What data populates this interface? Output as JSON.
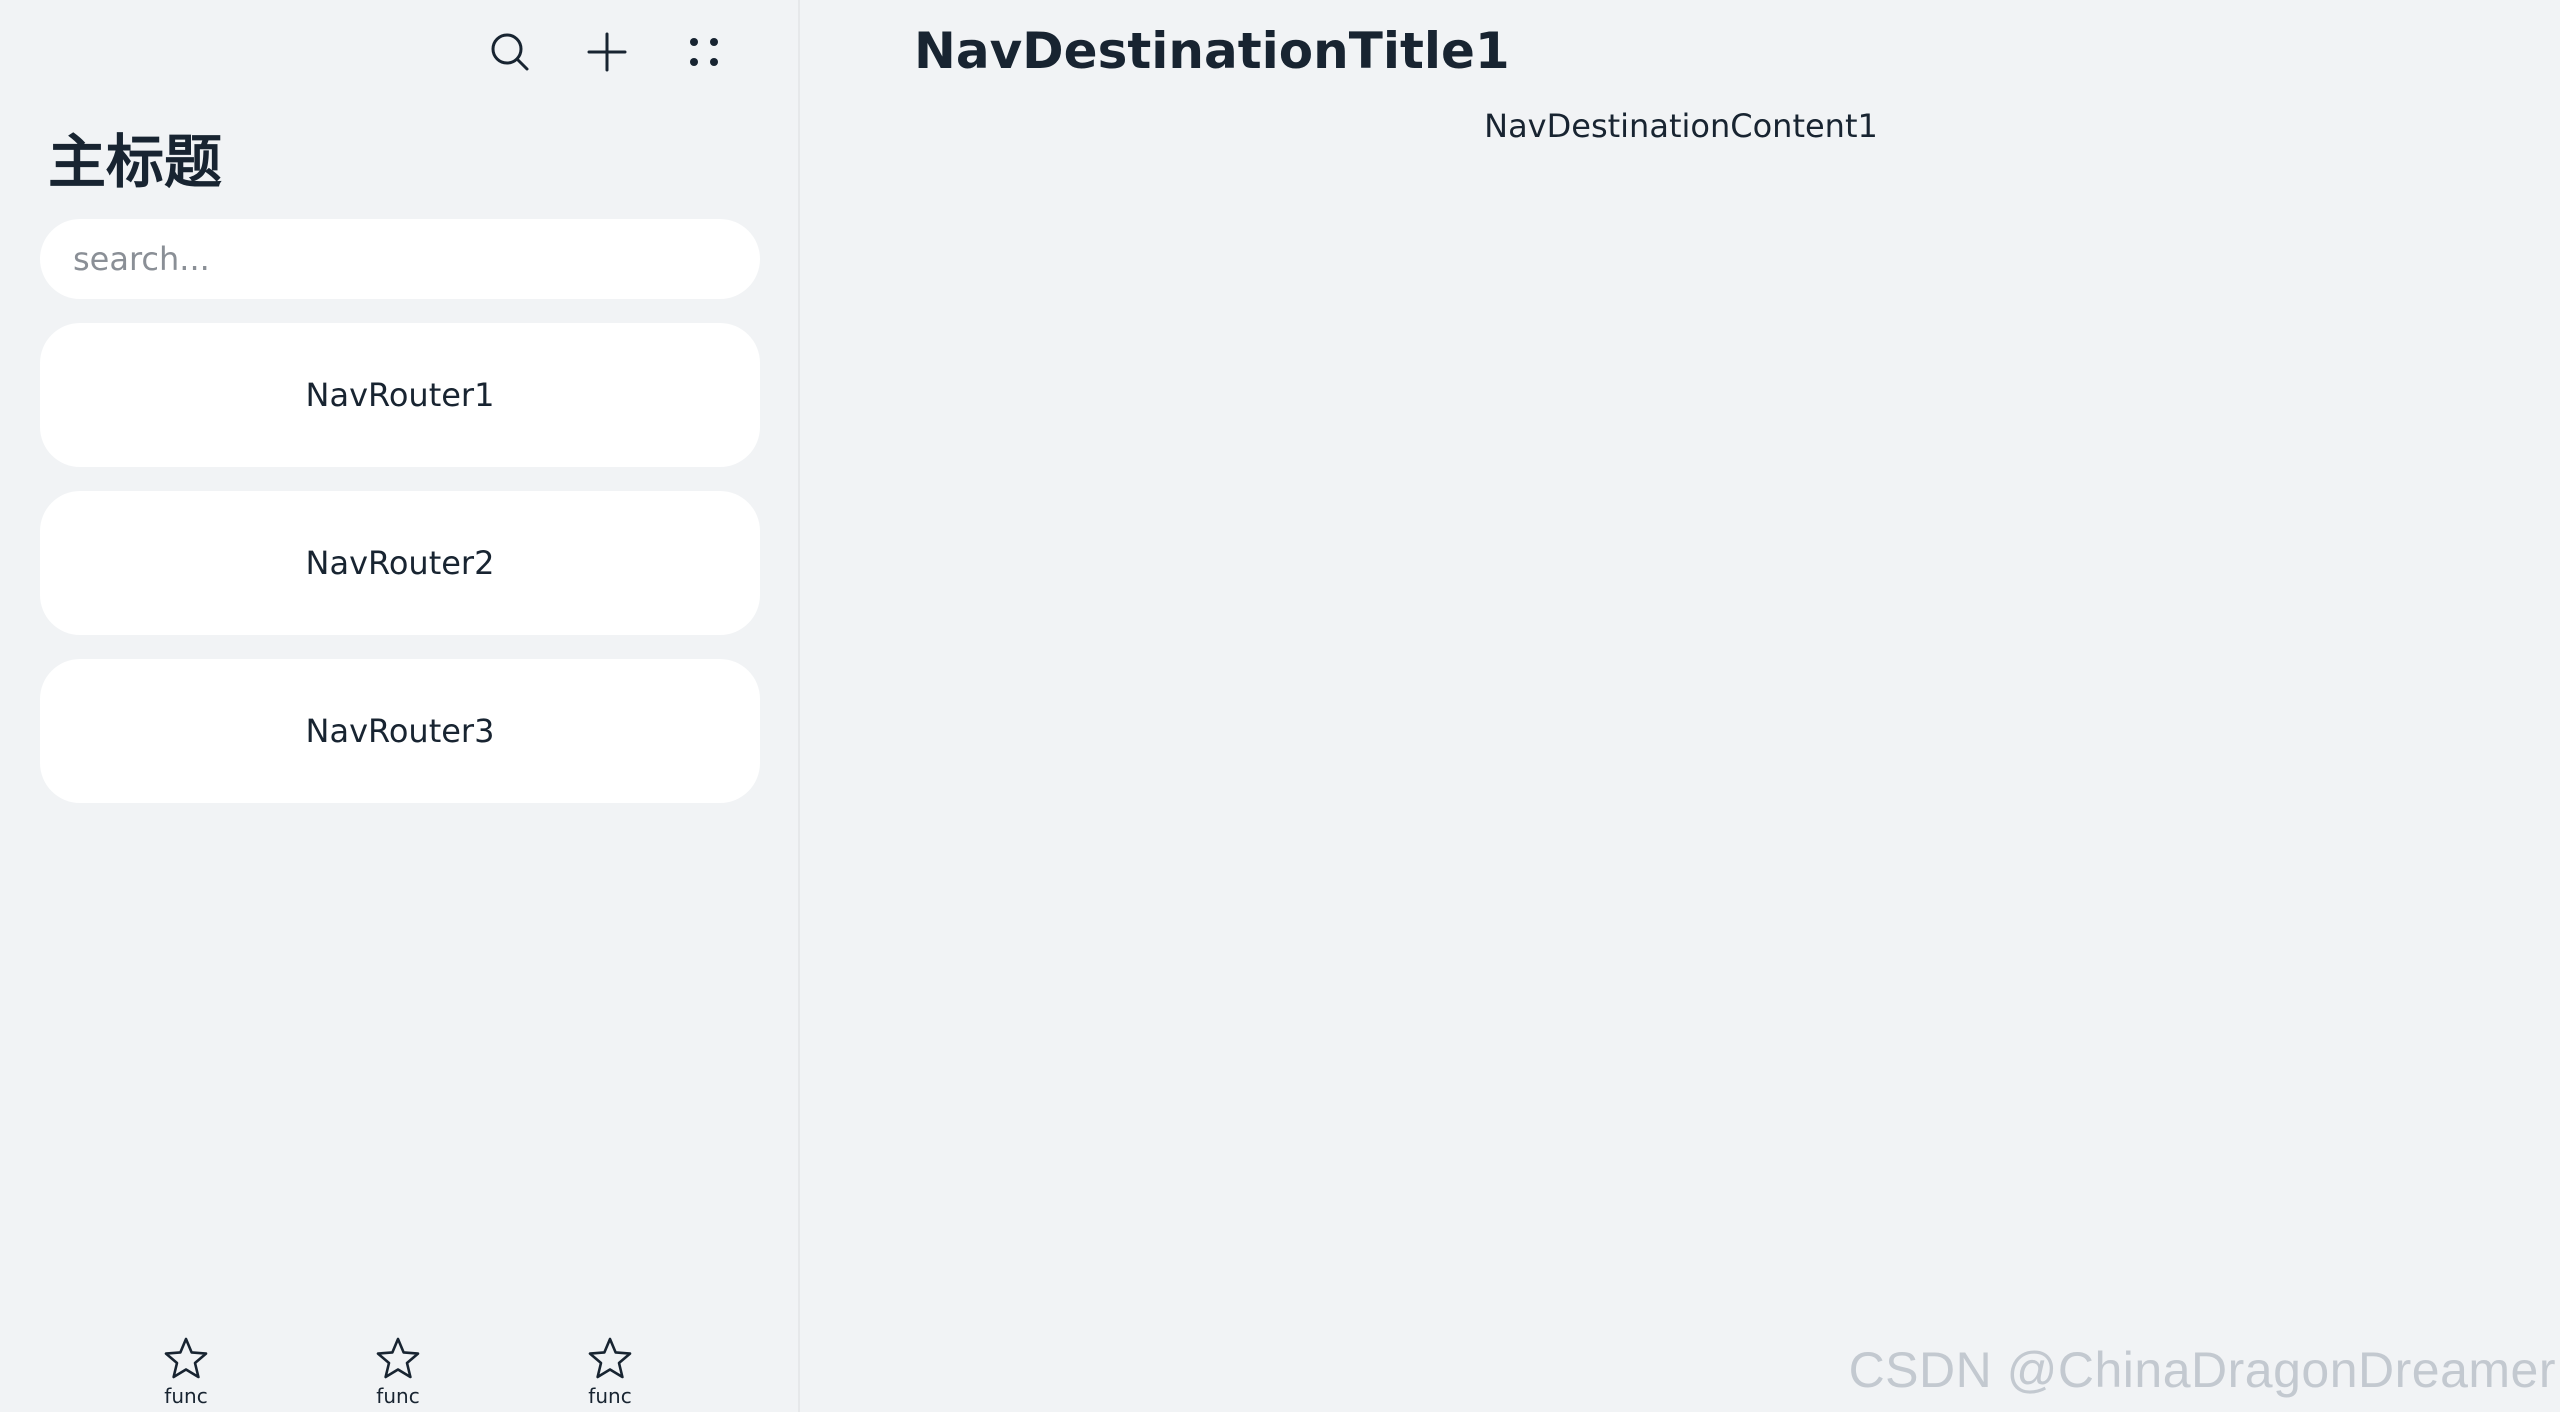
{
  "navigation": {
    "menus": [
      {
        "icon": "search-icon"
      },
      {
        "icon": "plus-icon"
      },
      {
        "icon": "more-dots-icon"
      }
    ],
    "title": "主标题",
    "search": {
      "placeholder": "search...",
      "value": ""
    },
    "routers": [
      {
        "label": "NavRouter1"
      },
      {
        "label": "NavRouter2"
      },
      {
        "label": "NavRouter3"
      }
    ],
    "toolbar": [
      {
        "label": "func",
        "icon": "star-icon"
      },
      {
        "label": "func",
        "icon": "star-icon"
      },
      {
        "label": "func",
        "icon": "star-icon"
      }
    ]
  },
  "destination": {
    "title": "NavDestinationTitle1",
    "content": "NavDestinationContent1"
  },
  "watermark": "CSDN @ChinaDragonDreamer",
  "colors": {
    "background": "#f1f3f5",
    "card": "#ffffff",
    "text": "#182431",
    "placeholder": "#8a8f96"
  }
}
